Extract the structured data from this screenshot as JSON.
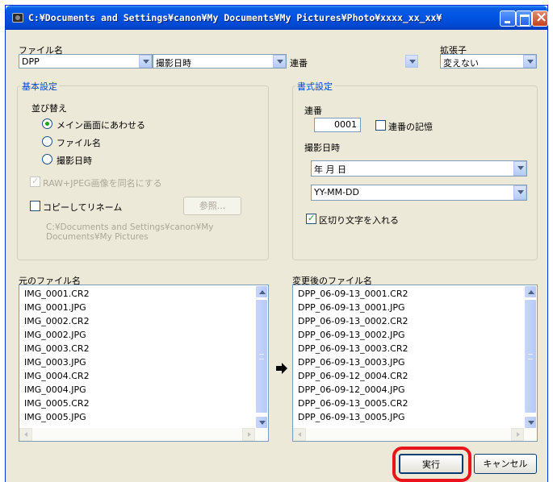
{
  "window": {
    "title": "C:¥Documents and Settings¥canon¥My Documents¥My Pictures¥Photo¥xxxx_xx_xx¥"
  },
  "filename_section": {
    "label": "ファイル名",
    "part1": "DPP",
    "part2": "撮影日時",
    "part3": "連番",
    "ext_label": "拡張子",
    "ext_value": "変えない"
  },
  "basic_settings": {
    "title": "基本設定",
    "sort_label": "並び替え",
    "sort_options": [
      {
        "label": "メイン画面にあわせる",
        "selected": true
      },
      {
        "label": "ファイル名",
        "selected": false
      },
      {
        "label": "撮影日時",
        "selected": false
      }
    ],
    "raw_jpeg_label": "RAW+JPEG画像を同名にする",
    "raw_jpeg_checked": true,
    "copy_rename_label": "コピーしてリネーム",
    "copy_rename_checked": false,
    "browse_button": "参照...",
    "copy_path": "C:¥Documents and Settings¥canon¥My Documents¥My Pictures"
  },
  "format_settings": {
    "title": "書式設定",
    "seq_label": "連番",
    "seq_value": "0001",
    "seq_memory_label": "連番の記憶",
    "seq_memory_checked": false,
    "date_label": "撮影日時",
    "date_order": "年 月 日",
    "date_format": "YY-MM-DD",
    "separator_label": "区切り文字を入れる",
    "separator_checked": true
  },
  "original_files": {
    "label": "元のファイル名",
    "items": [
      "IMG_0001.CR2",
      "IMG_0001.JPG",
      "IMG_0002.CR2",
      "IMG_0002.JPG",
      "IMG_0003.CR2",
      "IMG_0003.JPG",
      "IMG_0004.CR2",
      "IMG_0004.JPG",
      "IMG_0005.CR2",
      "IMG_0005.JPG"
    ]
  },
  "renamed_files": {
    "label": "変更後のファイル名",
    "items": [
      "DPP_06-09-13_0001.CR2",
      "DPP_06-09-13_0001.JPG",
      "DPP_06-09-13_0002.CR2",
      "DPP_06-09-13_0002.JPG",
      "DPP_06-09-13_0003.CR2",
      "DPP_06-09-13_0003.JPG",
      "DPP_06-09-12_0004.CR2",
      "DPP_06-09-12_0004.JPG",
      "DPP_06-09-13_0005.CR2",
      "DPP_06-09-13_0005.JPG"
    ]
  },
  "actions": {
    "execute": "実行",
    "cancel": "キャンセル"
  },
  "icons": {
    "arrow": "arrow-right-icon",
    "window": "camera-icon"
  },
  "colors": {
    "highlight": "#e8151b",
    "group_title": "#0046d5"
  }
}
